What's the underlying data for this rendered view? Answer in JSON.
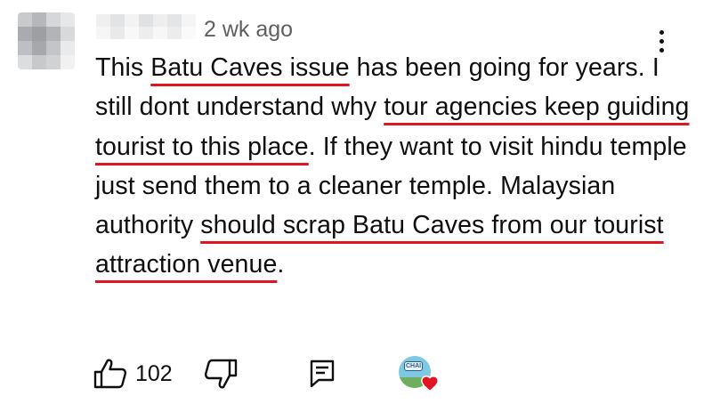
{
  "comment": {
    "timestamp": "2 wk ago",
    "segments": [
      {
        "text": "This ",
        "highlight": false
      },
      {
        "text": "Batu Caves issue",
        "highlight": true
      },
      {
        "text": " has been going for years. I still dont understand why ",
        "highlight": false
      },
      {
        "text": "tour agencies keep guiding tourist to this place",
        "highlight": true
      },
      {
        "text": ". If they want to visit hindu temple just send them to a cleaner temple. Malaysian authority ",
        "highlight": false
      },
      {
        "text": "should scrap Batu Caves from our tourist attraction venue",
        "highlight": true
      },
      {
        "text": ".",
        "highlight": false
      }
    ],
    "like_count": "102",
    "creator_badge_text": "CHAI"
  },
  "colors": {
    "highlight_underline": "#e2141f",
    "heart": "#e2141f",
    "timestamp": "#606060",
    "text": "#0f0f0f"
  },
  "icons": {
    "menu": "vertical-ellipsis-icon",
    "like": "thumbs-up-icon",
    "dislike": "thumbs-down-icon",
    "reply": "reply-comment-icon",
    "heart": "heart-icon"
  }
}
